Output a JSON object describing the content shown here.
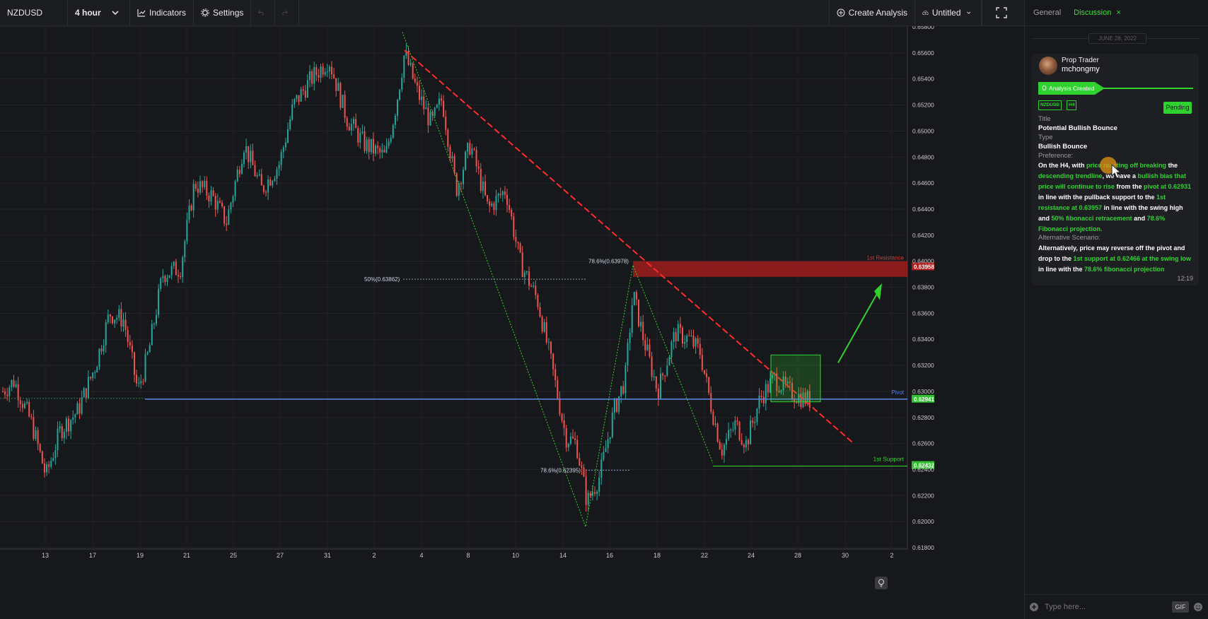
{
  "toolbar": {
    "symbol": "NZDUSD",
    "timeframe": "4 hour",
    "indicators_label": "Indicators",
    "settings_label": "Settings",
    "create_analysis_label": "Create Analysis",
    "layout_name": "Untitled"
  },
  "chart": {
    "price_labels": [
      "0.65800",
      "0.65600",
      "0.65400",
      "0.65200",
      "0.65000",
      "0.64800",
      "0.64600",
      "0.64400",
      "0.64200",
      "0.64000",
      "0.63800",
      "0.63600",
      "0.63400",
      "0.63200",
      "0.63000",
      "0.62800",
      "0.62600",
      "0.62400",
      "0.62200",
      "0.62000",
      "0.61800"
    ],
    "date_labels": [
      "13",
      "17",
      "19",
      "21",
      "25",
      "27",
      "31",
      "2",
      "4",
      "8",
      "10",
      "14",
      "16",
      "18",
      "22",
      "24",
      "28",
      "30",
      "2"
    ],
    "fib_labels": {
      "fib_50": "50%(0.63862)",
      "fib_786_top": "78.6%(0.63978)",
      "fib_786_bottom": "78.6%(0.62395)"
    },
    "levels": {
      "resistance_label": "1st Resistance",
      "resistance_value": "0.63958",
      "pivot_label": "Pivot",
      "pivot_value": "0.62941",
      "support_label": "1st Support",
      "support_value": "0.62432"
    },
    "colors": {
      "up": "#26a69a",
      "down": "#ef5350",
      "trendline": "#ff2b2b",
      "pivot": "#5b7fd6",
      "support": "#30d030",
      "resistance_zone": "#b21d1d"
    }
  },
  "sidebar": {
    "tab_general": "General",
    "tab_discussion": "Discussion",
    "date_divider": "JUNE 28, 2022",
    "author_role": "Prop Trader",
    "author_name": "mchongmy",
    "analysis_created": "Analysis Created",
    "tag_symbol": "NZDUSD",
    "tag_timeframe": "H4",
    "status": "Pending",
    "title_label": "Title",
    "title_value": "Potential Bullish Bounce",
    "type_label": "Type",
    "type_value": "Bullish Bounce",
    "preference_label": "Preference:",
    "preference_parts": [
      {
        "t": "On the H4, with ",
        "c": "w"
      },
      {
        "t": "price reacting off",
        "c": "g"
      },
      {
        "t": " ",
        "c": "w"
      },
      {
        "t": "breaking",
        "c": "g"
      },
      {
        "t": " the ",
        "c": "w"
      },
      {
        "t": "descending trendline",
        "c": "g"
      },
      {
        "t": ", we have a ",
        "c": "w"
      },
      {
        "t": "bullish bias that price will continue to rise",
        "c": "g"
      },
      {
        "t": " from the ",
        "c": "w"
      },
      {
        "t": "pivot at 0.62931",
        "c": "g"
      },
      {
        "t": " in line with the pullback support to the ",
        "c": "w"
      },
      {
        "t": "1st resistance at 0.63957",
        "c": "g"
      },
      {
        "t": " in line with the swing high and ",
        "c": "w"
      },
      {
        "t": "50% fibonacci retracement",
        "c": "g"
      },
      {
        "t": " and ",
        "c": "w"
      },
      {
        "t": "78.6% Fibonacci projection.",
        "c": "g"
      }
    ],
    "alt_label": "Alternative Scenario:",
    "alt_parts": [
      {
        "t": "Alternatively, price may reverse off the pivot and drop to the ",
        "c": "w"
      },
      {
        "t": "1st support at 0.62466 at the swing low",
        "c": "g"
      },
      {
        "t": " in line with the ",
        "c": "w"
      },
      {
        "t": "78.6% fibonacci projection",
        "c": "g"
      }
    ],
    "time": "12:19",
    "input_placeholder": "Type here...",
    "gif_label": "GIF"
  }
}
